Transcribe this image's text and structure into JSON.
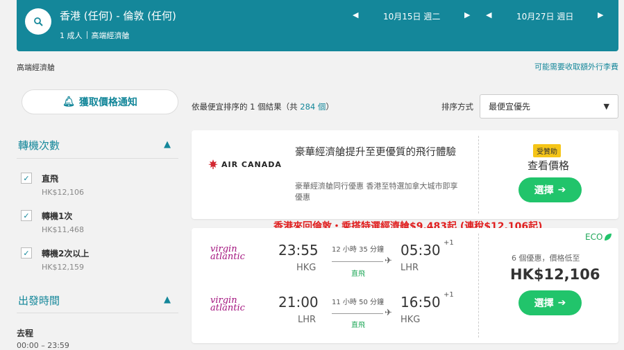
{
  "header": {
    "route": "香港 (任何) - 倫敦 (任何)",
    "passengers": "1 成人",
    "cabin": "高端經濟艙",
    "depart_date": "10月15日 週二",
    "return_date": "10月27日 週日"
  },
  "cabin_note": "高端經濟艙",
  "fees_link": "可能需要收取額外行李費",
  "price_alert": "獲取價格通知",
  "filters": {
    "stops_title": "轉機次數",
    "stops": [
      {
        "label": "直飛",
        "price": "HK$12,106",
        "checked": true
      },
      {
        "label": "轉機1次",
        "price": "HK$11,468",
        "checked": true
      },
      {
        "label": "轉機2次以上",
        "price": "HK$12,159",
        "checked": true
      }
    ],
    "depart_title": "出發時間",
    "outbound_label": "去程",
    "outbound_range": "00:00 – 23:59"
  },
  "results": {
    "prefix": "依",
    "sort_word": "最便宜",
    "middle": "排序的 1 個結果（共 ",
    "total": "284 個",
    "suffix": "）"
  },
  "sort": {
    "label": "排序方式",
    "value": "最便宜優先"
  },
  "ad": {
    "airline": "AIR CANADA",
    "headline": "豪華經濟艙提升至更優質的飛行體驗",
    "desc": "豪華經濟艙同行優惠 香港至特選加拿大城市即享優惠",
    "badge": "受贊助",
    "cta_title": "查看價格",
    "button": "選擇"
  },
  "promo": "香港來回倫敦・乘搭特選經濟艙$9,483起 (連稅$12,106起)",
  "flight": {
    "airline_line1": "virgin",
    "airline_line2": "atlantic",
    "eco": "ECO",
    "deals": "6 個優惠，價格低至",
    "price": "HK$12,106",
    "button": "選擇",
    "legs": [
      {
        "dep_time": "23:55",
        "dep_code": "HKG",
        "arr_time": "05:30",
        "plus": "+1",
        "arr_code": "LHR",
        "duration": "12 小時 35 分鐘",
        "stops": "直飛"
      },
      {
        "dep_time": "21:00",
        "dep_code": "LHR",
        "arr_time": "16:50",
        "plus": "+1",
        "arr_code": "HKG",
        "duration": "11 小時 50 分鐘",
        "stops": "直飛"
      }
    ]
  },
  "icons": {
    "search": "search-icon",
    "bell": "bell-icon",
    "chevron_left": "chevron-left-icon",
    "chevron_right": "chevron-right-icon",
    "caret_up": "caret-up-icon",
    "caret_down": "caret-down-icon",
    "plane": "plane-icon",
    "leaf": "leaf-icon",
    "arrow_right": "arrow-right-icon"
  },
  "colors": {
    "teal": "#14879a",
    "green": "#21c46b",
    "red_promo": "#e02020",
    "badge": "#f5c518",
    "virgin": "#a3137e",
    "air_canada": "#d22630"
  }
}
